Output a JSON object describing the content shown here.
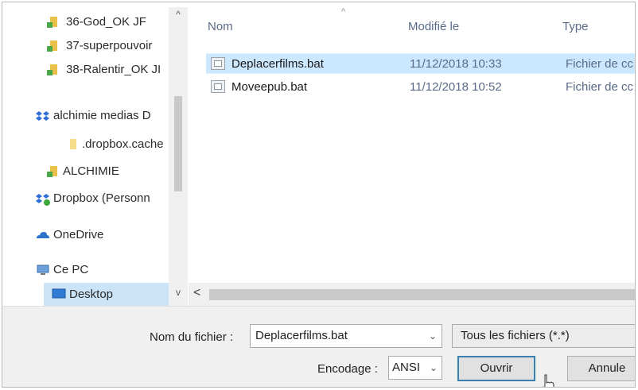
{
  "sidebar": {
    "items": [
      {
        "label": "36-God_OK JF",
        "icon": "folder-shortcut-icon"
      },
      {
        "label": "37-superpouvoir",
        "icon": "folder-shortcut-icon"
      },
      {
        "label": "38-Ralentir_OK JI",
        "icon": "folder-shortcut-icon"
      },
      {
        "label": "alchimie medias D",
        "icon": "dropbox-icon"
      },
      {
        "label": ".dropbox.cache",
        "icon": "folder-icon"
      },
      {
        "label": "ALCHIMIE",
        "icon": "folder-shortcut-icon"
      },
      {
        "label": "Dropbox (Personn",
        "icon": "dropbox-sync-icon"
      },
      {
        "label": "OneDrive",
        "icon": "onedrive-icon"
      },
      {
        "label": "Ce PC",
        "icon": "pc-icon"
      },
      {
        "label": "Desktop",
        "icon": "desktop-icon"
      }
    ],
    "selected": "Desktop"
  },
  "filelist": {
    "columns": {
      "name": "Nom",
      "modified": "Modifié le",
      "type": "Type"
    },
    "rows": [
      {
        "name": "Deplacerfilms.bat",
        "modified": "11/12/2018 10:33",
        "type": "Fichier de cc"
      },
      {
        "name": "Moveepub.bat",
        "modified": "11/12/2018 10:52",
        "type": "Fichier de cc"
      }
    ],
    "selected_row": "Deplacerfilms.bat"
  },
  "bottom": {
    "filename_label": "Nom du fichier :",
    "filename_value": "Deplacerfilms.bat",
    "filter_value": "Tous les fichiers  (*.*)",
    "encoding_label": "Encodage :",
    "encoding_value": "ANSI",
    "open_label": "Ouvrir",
    "cancel_label": "Annule"
  },
  "colors": {
    "selected_bg": "#cce8ff",
    "nav_selected_bg": "#cce4f7",
    "primary_border": "#3c7fb1"
  }
}
